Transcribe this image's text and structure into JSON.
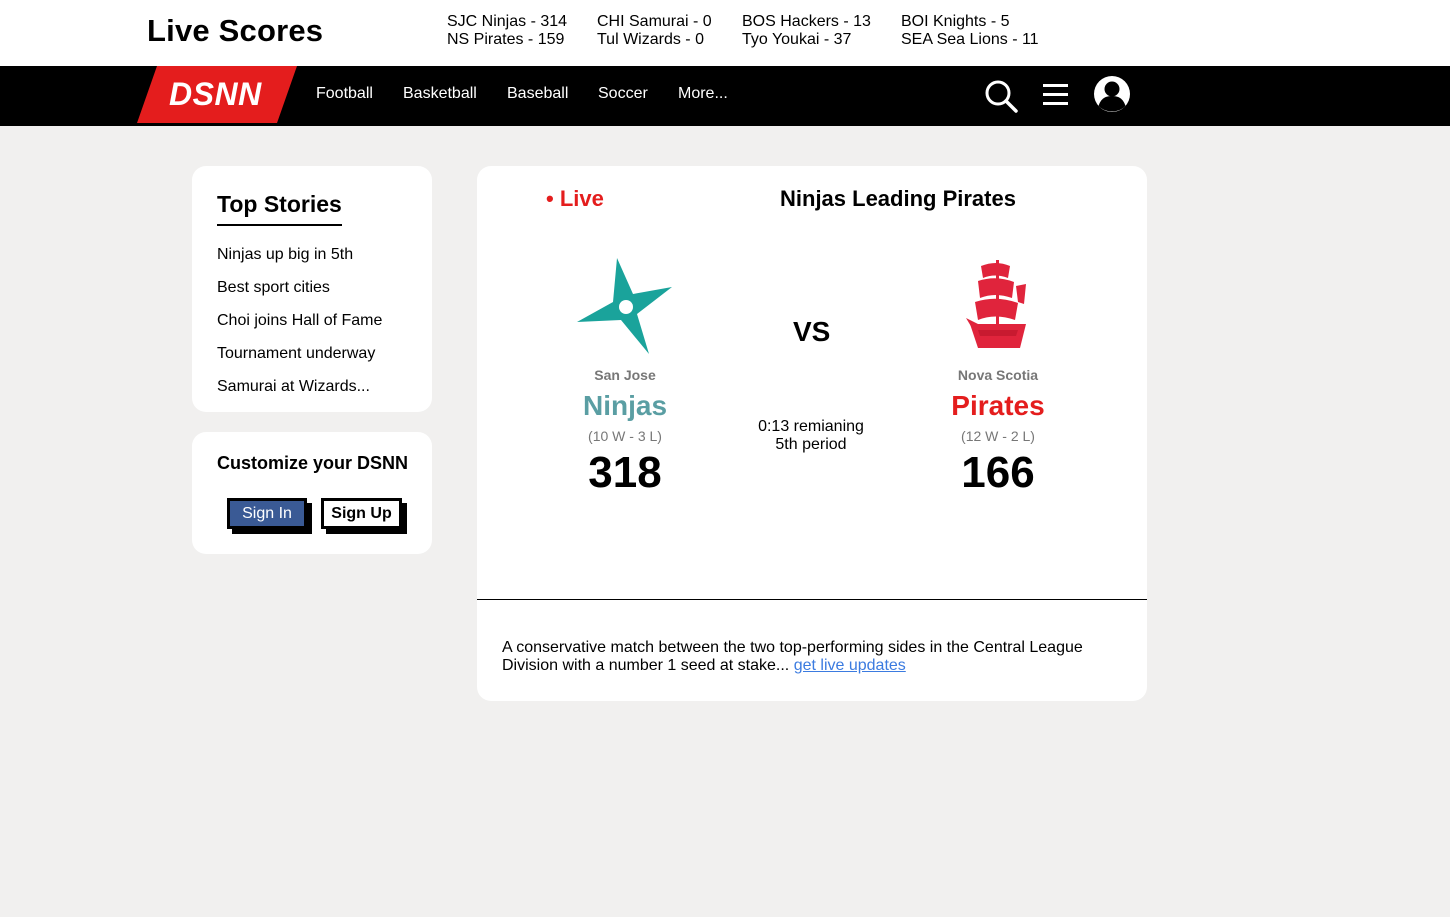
{
  "header": {
    "title": "Live Scores",
    "ticker": [
      {
        "home": "SJC Ninjas - 314",
        "away": "NS Pirates - 159"
      },
      {
        "home": "CHI Samurai - 0",
        "away": "Tul Wizards - 0"
      },
      {
        "home": "BOS Hackers - 13",
        "away": "Tyo Youkai - 37"
      },
      {
        "home": "BOI Knights - 5",
        "away": "SEA Sea Lions - 11"
      }
    ]
  },
  "nav": {
    "logo": "DSNN",
    "links": [
      "Football",
      "Basketball",
      "Baseball",
      "Soccer",
      "More..."
    ],
    "icons": [
      "search-icon",
      "menu-icon",
      "user-avatar-icon"
    ]
  },
  "top_stories": {
    "title": "Top Stories",
    "items": [
      "Ninjas up big in 5th",
      "Best sport cities",
      "Choi joins Hall of Fame",
      "Tournament underway",
      "Samurai at Wizards..."
    ]
  },
  "customize": {
    "title": "Customize your DSNN",
    "sign_in": "Sign In",
    "sign_up": "Sign Up"
  },
  "game": {
    "live_label": "• Live",
    "headline": "Ninjas Leading Pirates",
    "vs": "VS",
    "home": {
      "city": "San Jose",
      "name": "Ninjas",
      "record": "(10 W - 3 L)",
      "score": "318",
      "color": "#5a9ea3"
    },
    "away": {
      "city": "Nova Scotia",
      "name": "Pirates",
      "record": "(12 W - 2 L)",
      "score": "166",
      "color": "#e41d1d"
    },
    "clock": {
      "time": "0:13 remianing",
      "period": "5th period"
    },
    "description": "A conservative match between the two top-performing sides in the Central League Division with a number 1 seed at stake...",
    "link": "get live updates"
  },
  "colors": {
    "accent": "#e41d1d",
    "ninja_teal": "#1aa39b",
    "signin_blue": "#3a5a95",
    "link": "#3b7be0"
  }
}
